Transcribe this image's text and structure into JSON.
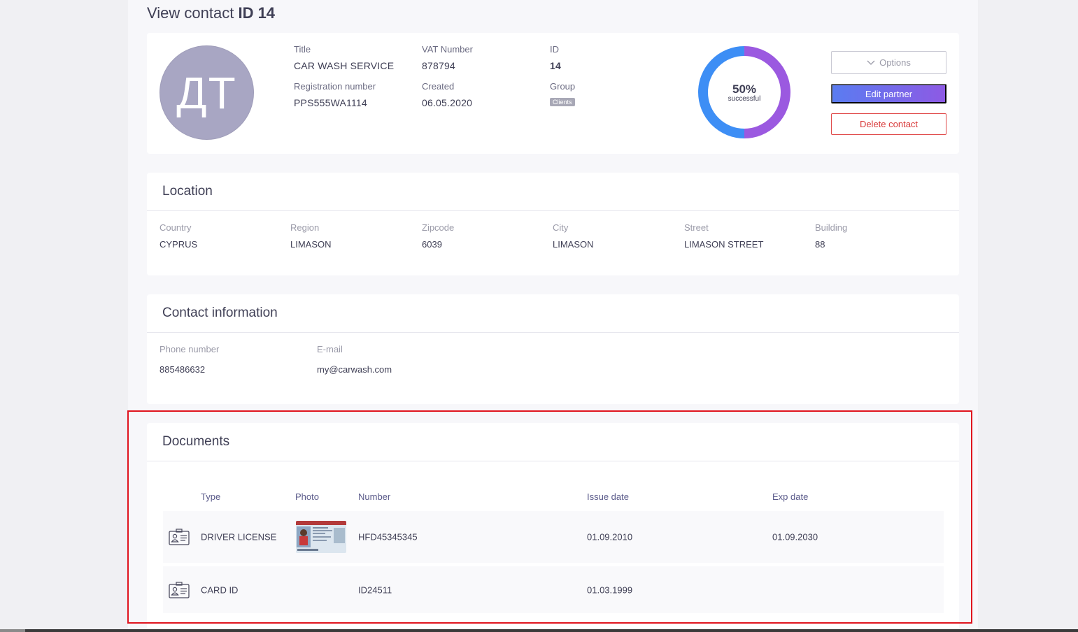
{
  "page": {
    "title_prefix": "View contact ",
    "title_id": "ID 14"
  },
  "profile": {
    "avatar_initials": "ДТ",
    "fields": {
      "title": {
        "label": "Title",
        "value": "CAR WASH SERVICE"
      },
      "vat": {
        "label": "VAT Number",
        "value": "878794"
      },
      "id": {
        "label": "ID",
        "value": "14"
      },
      "registration": {
        "label": "Registration number",
        "value": "PPS555WA1114"
      },
      "created": {
        "label": "Created",
        "value": "06.05.2020"
      },
      "group": {
        "label": "Group",
        "value": "Clients"
      }
    },
    "success": {
      "percent_value": 50,
      "percent_label": "50%",
      "caption": "successful"
    },
    "colors": {
      "ring_left": "#3d8ef5",
      "ring_right": "#9b59e0"
    }
  },
  "actions": {
    "options_label": "Options",
    "edit_label": "Edit partner",
    "delete_label": "Delete contact"
  },
  "location": {
    "heading": "Location",
    "fields": [
      {
        "label": "Country",
        "value": "CYPRUS"
      },
      {
        "label": "Region",
        "value": "LIMASON"
      },
      {
        "label": "Zipcode",
        "value": "6039"
      },
      {
        "label": "City",
        "value": "LIMASON"
      },
      {
        "label": "Street",
        "value": "LIMASON STREET"
      },
      {
        "label": "Building",
        "value": "88"
      }
    ]
  },
  "contact": {
    "heading": "Contact information",
    "phone": {
      "label": "Phone number",
      "value": "885486632"
    },
    "email": {
      "label": "E-mail",
      "value": "my@carwash.com"
    }
  },
  "documents": {
    "heading": "Documents",
    "columns": [
      "Type",
      "Photo",
      "Number",
      "Issue date",
      "Exp date"
    ],
    "rows": [
      {
        "type": "DRIVER LICENSE",
        "has_photo": true,
        "number": "HFD45345345",
        "issue": "01.09.2010",
        "exp": "01.09.2030"
      },
      {
        "type": "CARD ID",
        "has_photo": false,
        "number": "ID24511",
        "issue": "01.03.1999",
        "exp": ""
      }
    ]
  }
}
